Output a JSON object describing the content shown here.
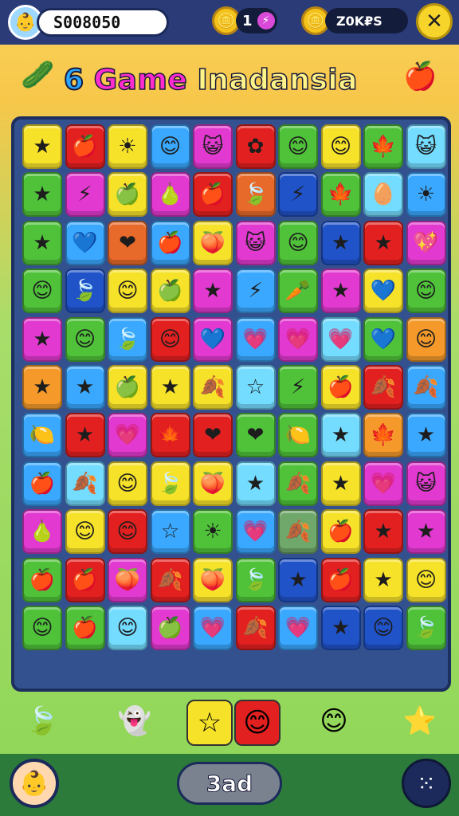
{
  "header": {
    "avatar_icon": "👶",
    "score": "S008050",
    "coins_value": "1",
    "coin_icon": "🪙",
    "bolt_icon": "⚡",
    "gems_value": "Z0K₽S",
    "close_icon": "✕"
  },
  "title": {
    "num": "6",
    "game": "Game",
    "name": "Inadansia"
  },
  "decor": {
    "left_icon": "🥒",
    "right_icon": "🍎"
  },
  "board": {
    "tiles": [
      {
        "bg": "#f7e22a",
        "icon": "★"
      },
      {
        "bg": "#e32020",
        "icon": "🍎"
      },
      {
        "bg": "#f7e22a",
        "icon": "☀"
      },
      {
        "bg": "#3aa8ff",
        "icon": "😊"
      },
      {
        "bg": "#e23ad0",
        "icon": "😺"
      },
      {
        "bg": "#e32020",
        "icon": "✿"
      },
      {
        "bg": "#4fc23a",
        "icon": "😊"
      },
      {
        "bg": "#f7e22a",
        "icon": "😊"
      },
      {
        "bg": "#4fc23a",
        "icon": "🍁"
      },
      {
        "bg": "#73dcff",
        "icon": "😺"
      },
      {
        "bg": "#4fc23a",
        "icon": "★"
      },
      {
        "bg": "#e23ad0",
        "icon": "⚡"
      },
      {
        "bg": "#f7e22a",
        "icon": "🍏"
      },
      {
        "bg": "#e23ad0",
        "icon": "🍐"
      },
      {
        "bg": "#e32020",
        "icon": "🍎"
      },
      {
        "bg": "#e86a2a",
        "icon": "🍃"
      },
      {
        "bg": "#2052c8",
        "icon": "⚡"
      },
      {
        "bg": "#4fc23a",
        "icon": "🍁"
      },
      {
        "bg": "#73dcff",
        "icon": "🥚"
      },
      {
        "bg": "#3aa8ff",
        "icon": "☀"
      },
      {
        "bg": "#4fc23a",
        "icon": "★"
      },
      {
        "bg": "#3aa8ff",
        "icon": "💙"
      },
      {
        "bg": "#e86a2a",
        "icon": "❤"
      },
      {
        "bg": "#3aa8ff",
        "icon": "🍎"
      },
      {
        "bg": "#f7e22a",
        "icon": "🍑"
      },
      {
        "bg": "#e23ad0",
        "icon": "😺"
      },
      {
        "bg": "#4fc23a",
        "icon": "😊"
      },
      {
        "bg": "#2052c8",
        "icon": "★"
      },
      {
        "bg": "#e32020",
        "icon": "★"
      },
      {
        "bg": "#e23ad0",
        "icon": "💖"
      },
      {
        "bg": "#4fc23a",
        "icon": "😊"
      },
      {
        "bg": "#2052c8",
        "icon": "🍃"
      },
      {
        "bg": "#f7e22a",
        "icon": "😊"
      },
      {
        "bg": "#f7e22a",
        "icon": "🍏"
      },
      {
        "bg": "#e23ad0",
        "icon": "★"
      },
      {
        "bg": "#3aa8ff",
        "icon": "⚡"
      },
      {
        "bg": "#4fc23a",
        "icon": "🥕"
      },
      {
        "bg": "#e23ad0",
        "icon": "★"
      },
      {
        "bg": "#f7e22a",
        "icon": "💙"
      },
      {
        "bg": "#4fc23a",
        "icon": "😊"
      },
      {
        "bg": "#e23ad0",
        "icon": "★"
      },
      {
        "bg": "#4fc23a",
        "icon": "😊"
      },
      {
        "bg": "#3aa8ff",
        "icon": "🍃"
      },
      {
        "bg": "#e32020",
        "icon": "😊"
      },
      {
        "bg": "#e23ad0",
        "icon": "💙"
      },
      {
        "bg": "#3aa8ff",
        "icon": "💗"
      },
      {
        "bg": "#e23ad0",
        "icon": "💗"
      },
      {
        "bg": "#73dcff",
        "icon": "💗"
      },
      {
        "bg": "#4fc23a",
        "icon": "💙"
      },
      {
        "bg": "#f59a2a",
        "icon": "😊"
      },
      {
        "bg": "#f59a2a",
        "icon": "★"
      },
      {
        "bg": "#3aa8ff",
        "icon": "★"
      },
      {
        "bg": "#f7e22a",
        "icon": "🍏"
      },
      {
        "bg": "#f7e22a",
        "icon": "★"
      },
      {
        "bg": "#f7e22a",
        "icon": "🍂"
      },
      {
        "bg": "#73dcff",
        "icon": "☆"
      },
      {
        "bg": "#4fc23a",
        "icon": "⚡"
      },
      {
        "bg": "#f7e22a",
        "icon": "🍎"
      },
      {
        "bg": "#e32020",
        "icon": "🍂"
      },
      {
        "bg": "#3aa8ff",
        "icon": "🍂"
      },
      {
        "bg": "#3aa8ff",
        "icon": "🍋"
      },
      {
        "bg": "#e32020",
        "icon": "★"
      },
      {
        "bg": "#e23ad0",
        "icon": "💗"
      },
      {
        "bg": "#e32020",
        "icon": "🍁"
      },
      {
        "bg": "#e32020",
        "icon": "❤"
      },
      {
        "bg": "#4fc23a",
        "icon": "❤"
      },
      {
        "bg": "#4fc23a",
        "icon": "🍋"
      },
      {
        "bg": "#73dcff",
        "icon": "★"
      },
      {
        "bg": "#f59a2a",
        "icon": "🍁"
      },
      {
        "bg": "#3aa8ff",
        "icon": "★"
      },
      {
        "bg": "#3aa8ff",
        "icon": "🍎"
      },
      {
        "bg": "#73dcff",
        "icon": "🍂"
      },
      {
        "bg": "#f7e22a",
        "icon": "😊"
      },
      {
        "bg": "#f7e22a",
        "icon": "🍃"
      },
      {
        "bg": "#f7e22a",
        "icon": "🍑"
      },
      {
        "bg": "#73dcff",
        "icon": "★"
      },
      {
        "bg": "#4fc23a",
        "icon": "🍂"
      },
      {
        "bg": "#f7e22a",
        "icon": "★"
      },
      {
        "bg": "#e23ad0",
        "icon": "💗"
      },
      {
        "bg": "#e23ad0",
        "icon": "😺"
      },
      {
        "bg": "#e23ad0",
        "icon": "🍐"
      },
      {
        "bg": "#f7e22a",
        "icon": "😊"
      },
      {
        "bg": "#e32020",
        "icon": "😊"
      },
      {
        "bg": "#3aa8ff",
        "icon": "☆"
      },
      {
        "bg": "#4fc23a",
        "icon": "☀"
      },
      {
        "bg": "#3aa8ff",
        "icon": "💗"
      },
      {
        "bg": "#6fa86a",
        "icon": "🍂"
      },
      {
        "bg": "#f7e22a",
        "icon": "🍎"
      },
      {
        "bg": "#e32020",
        "icon": "★"
      },
      {
        "bg": "#e23ad0",
        "icon": "★"
      },
      {
        "bg": "#4fc23a",
        "icon": "🍎"
      },
      {
        "bg": "#e32020",
        "icon": "🍎"
      },
      {
        "bg": "#e23ad0",
        "icon": "🍑"
      },
      {
        "bg": "#e32020",
        "icon": "🍂"
      },
      {
        "bg": "#f7e22a",
        "icon": "🍑"
      },
      {
        "bg": "#4fc23a",
        "icon": "🍃"
      },
      {
        "bg": "#2052c8",
        "icon": "★"
      },
      {
        "bg": "#e32020",
        "icon": "🍎"
      },
      {
        "bg": "#f7e22a",
        "icon": "★"
      },
      {
        "bg": "#f7e22a",
        "icon": "😊"
      },
      {
        "bg": "#4fc23a",
        "icon": "😊"
      },
      {
        "bg": "#4fc23a",
        "icon": "🍎"
      },
      {
        "bg": "#73dcff",
        "icon": "😊"
      },
      {
        "bg": "#e23ad0",
        "icon": "🍏"
      },
      {
        "bg": "#3aa8ff",
        "icon": "💗"
      },
      {
        "bg": "#e32020",
        "icon": "🍂"
      },
      {
        "bg": "#3aa8ff",
        "icon": "💗"
      },
      {
        "bg": "#2052c8",
        "icon": "★"
      },
      {
        "bg": "#2052c8",
        "icon": "😊"
      },
      {
        "bg": "#4fc23a",
        "icon": "🍃"
      }
    ]
  },
  "tray": [
    {
      "icon": "🍃",
      "bg": "transparent"
    },
    {
      "icon": "👻",
      "bg": "transparent"
    },
    {
      "icon": "☆",
      "bg": "#f7e22a"
    },
    {
      "icon": "😊",
      "bg": "#e32020"
    },
    {
      "icon": "😊",
      "bg": "transparent"
    },
    {
      "icon": "⭐",
      "bg": "transparent"
    }
  ],
  "bottom": {
    "profile_icon": "👶",
    "center_label": "3ad",
    "menu_icon": "⁙"
  }
}
